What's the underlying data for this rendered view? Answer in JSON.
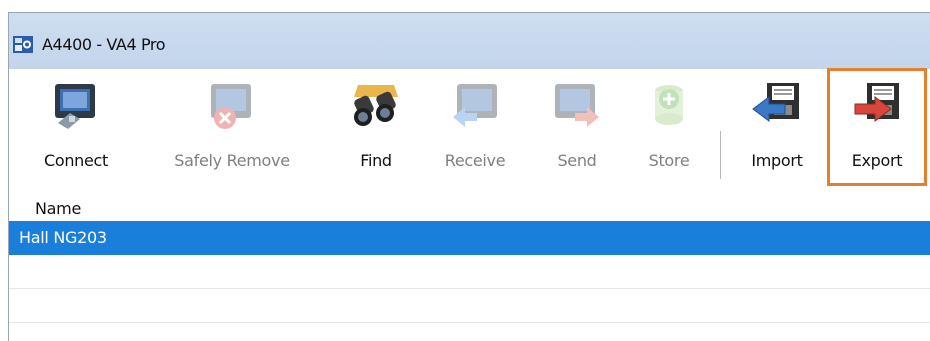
{
  "window": {
    "title": "A4400 - VA4 Pro"
  },
  "toolbar": {
    "buttons": [
      {
        "label": "Connect",
        "icon": "connect-icon",
        "enabled": true
      },
      {
        "label": "Safely Remove",
        "icon": "safely-remove-icon",
        "enabled": false
      },
      {
        "label": "Find",
        "icon": "binoculars-icon",
        "enabled": true
      },
      {
        "label": "Receive",
        "icon": "receive-icon",
        "enabled": false
      },
      {
        "label": "Send",
        "icon": "send-icon",
        "enabled": false
      },
      {
        "label": "Store",
        "icon": "store-icon",
        "enabled": false
      },
      {
        "label": "Import",
        "icon": "import-icon",
        "enabled": true
      },
      {
        "label": "Export",
        "icon": "export-icon",
        "enabled": true,
        "highlighted": true
      }
    ],
    "highlight_color": "#E57F2E"
  },
  "list": {
    "column_header": "Name",
    "rows": [
      {
        "name": "Hall NG203",
        "selected": true
      },
      {
        "name": "",
        "selected": false
      },
      {
        "name": "",
        "selected": false
      }
    ],
    "selection_color": "#1A7FDB"
  }
}
